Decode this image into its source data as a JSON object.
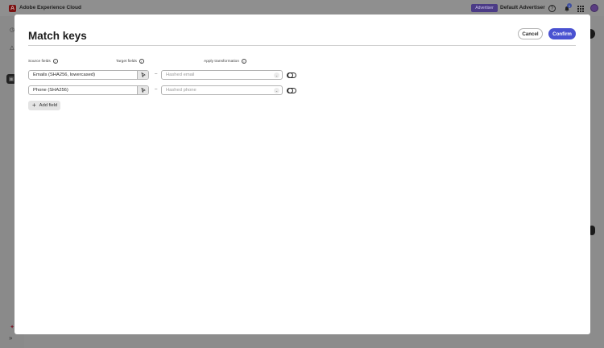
{
  "app": {
    "brand_logo_letter": "A",
    "brand_name": "Adobe Experience Cloud",
    "advertiser_badge": "Advertiser",
    "advertiser_name": "Default Advertiser",
    "notification_count": "1",
    "icons": [
      "help-icon",
      "bell-icon",
      "apps-grid-icon",
      "avatar"
    ]
  },
  "modal": {
    "title": "Match keys",
    "cancel_label": "Cancel",
    "confirm_label": "Confirm",
    "columns": {
      "source": "Source fields",
      "target": "Target fields",
      "transform": "Apply transformation"
    },
    "rows": [
      {
        "source_value": "Emails (SHA256, lowercased)",
        "target_placeholder": "Hashed email",
        "transformation_on": false
      },
      {
        "source_value": "Phone (SHA256)",
        "target_placeholder": "Hashed phone",
        "transformation_on": false
      }
    ],
    "add_field_label": "Add field",
    "separator": "–"
  },
  "colors": {
    "accent": "#4a52d1",
    "overlay": "#8c8c8c",
    "advertiser_badge": "#4b3b86"
  }
}
